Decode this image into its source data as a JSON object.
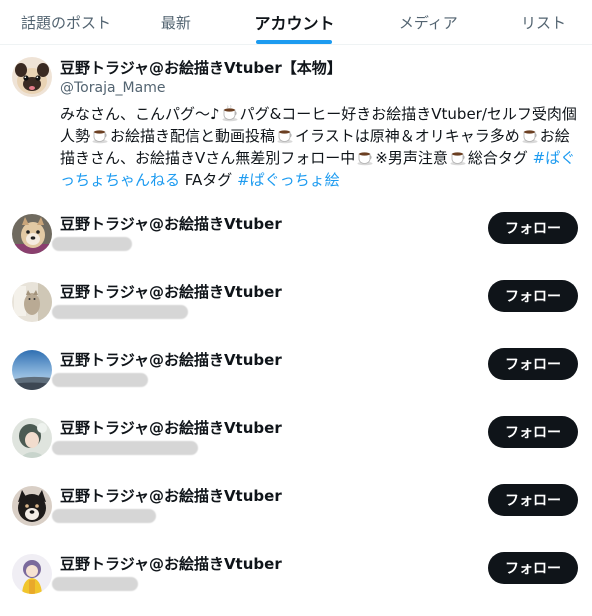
{
  "tabs": [
    {
      "label": "話題のポスト",
      "active": false
    },
    {
      "label": "最新",
      "active": false
    },
    {
      "label": "アカウント",
      "active": true
    },
    {
      "label": "メディア",
      "active": false
    },
    {
      "label": "リスト",
      "active": false
    }
  ],
  "accent_color": "#1d9bf0",
  "main_profile": {
    "name": "豆野トラジャ@お絵描きVtuber【本物】",
    "handle": "@Toraja_Mame",
    "bio": {
      "seg1": "みなさん、こんパグ〜♪",
      "seg2": "パグ&コーヒー好きお絵描きVtuber/セルフ受肉個人勢",
      "seg3": "お絵描き配信と動画投稿",
      "seg4": "イラストは原神＆オリキャラ多め",
      "seg5": "お絵描きさん、お絵描きVさん無差別フォロー中",
      "seg6": "※男声注意",
      "seg7": "総合タグ ",
      "hashtag1": "#ぱぐっちょちゃんねる",
      "seg8": " FAタグ ",
      "hashtag2": "#ぱぐっちょ絵"
    },
    "bio_icon": "coffee-cup-icon"
  },
  "accounts": [
    {
      "name": "豆野トラジャ@お絵描きVtuber",
      "follow_label": "フォロー",
      "avatar": "shiba-dog-avatar"
    },
    {
      "name": "豆野トラジャ@お絵描きVtuber",
      "follow_label": "フォロー",
      "avatar": "cat-avatar"
    },
    {
      "name": "豆野トラジャ@お絵描きVtuber",
      "follow_label": "フォロー",
      "avatar": "sky-landscape-avatar"
    },
    {
      "name": "豆野トラジャ@お絵描きVtuber",
      "follow_label": "フォロー",
      "avatar": "illustration-avatar"
    },
    {
      "name": "豆野トラジャ@お絵描きVtuber",
      "follow_label": "フォロー",
      "avatar": "black-dog-avatar"
    },
    {
      "name": "豆野トラジャ@お絵描きVtuber",
      "follow_label": "フォロー",
      "avatar": "yellow-character-avatar"
    }
  ]
}
